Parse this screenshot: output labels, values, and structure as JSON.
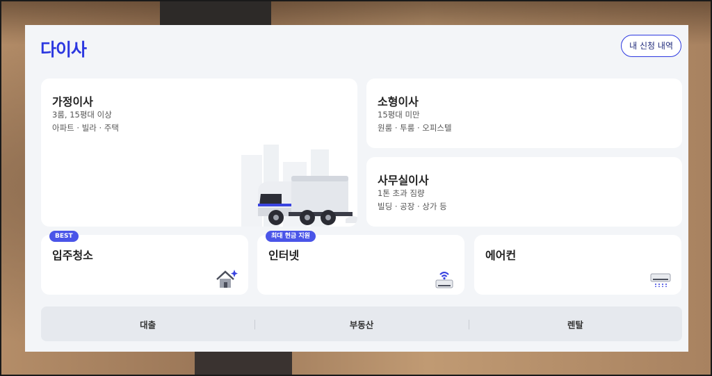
{
  "header": {
    "logo_text": "다이사",
    "history_button": "내 신청 내역"
  },
  "main_cards": [
    {
      "title": "가정이사",
      "line1": "3룸, 15평대 이상",
      "line2": "아파트 · 빌라 · 주택"
    },
    {
      "title": "소형이사",
      "line1": "15평대 미만",
      "line2": "원룸 · 투룸 · 오피스텔"
    },
    {
      "title": "사무실이사",
      "line1": "1톤 초과 짐량",
      "line2": "빌딩 · 공장 · 상가 등"
    }
  ],
  "service_cards": [
    {
      "title": "입주청소",
      "badge": "BEST",
      "icon": "house-sparkle-icon"
    },
    {
      "title": "인터넷",
      "badge": "최대 현금 지원",
      "icon": "wifi-router-icon"
    },
    {
      "title": "에어컨",
      "badge": "",
      "icon": "air-conditioner-icon"
    }
  ],
  "bottom_links": [
    "대출",
    "부동산",
    "렌탈"
  ],
  "colors": {
    "brand": "#2b37e0",
    "badge": "#4a55e8",
    "panel_bg": "#f3f5f8",
    "bottom_bar_bg": "#e6e9ee"
  }
}
